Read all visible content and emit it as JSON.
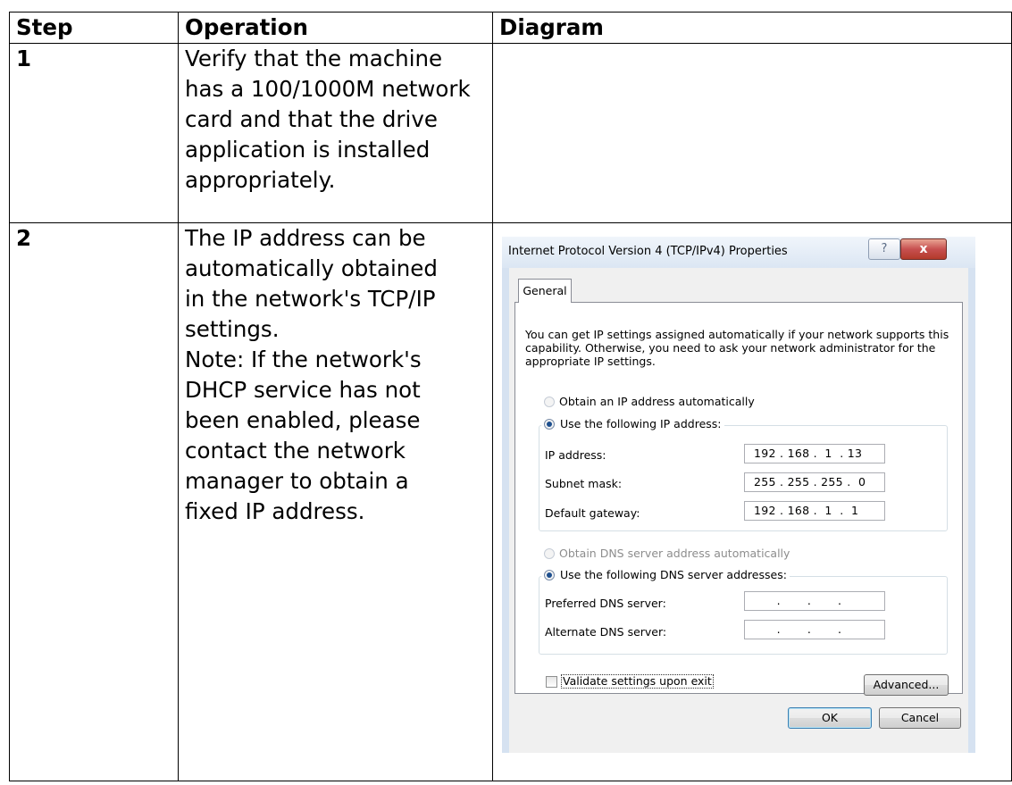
{
  "table": {
    "headers": {
      "step": "Step",
      "operation": "Operation",
      "diagram": "Diagram"
    },
    "rows": [
      {
        "step": "1",
        "operation": "Verify that the machine has a 100/1000M network card and that the drive application is installed appropriately."
      },
      {
        "step": "2",
        "operation_lines": [
          "The IP address can be",
          "automatically obtained",
          "in the network's TCP/IP",
          "settings.",
          "Note: If the network's",
          "DHCP service has not",
          "been enabled, please",
          "contact the network",
          "manager to obtain a",
          "fixed IP address."
        ]
      }
    ]
  },
  "dialog": {
    "title": "Internet Protocol Version 4 (TCP/IPv4) Properties",
    "help_label": "?",
    "close_label": "x",
    "tab": "General",
    "description": "You can get IP settings assigned automatically if your network supports this capability. Otherwise, you need to ask your network administrator for the appropriate IP settings.",
    "obtain_ip_auto": "Obtain an IP address automatically",
    "use_following_ip": "Use the following IP address:",
    "ip_address_label": "IP address:",
    "ip_address_value": "192 . 168 .  1  . 13",
    "subnet_mask_label": "Subnet mask:",
    "subnet_mask_value": "255 . 255 . 255 .  0",
    "default_gateway_label": "Default gateway:",
    "default_gateway_value": "192 . 168 .  1  .  1",
    "obtain_dns_auto": "Obtain DNS server address automatically",
    "use_following_dns": "Use the following DNS server addresses:",
    "preferred_dns_label": "Preferred DNS server:",
    "preferred_dns_value": "      .       .       .",
    "alternate_dns_label": "Alternate DNS server:",
    "alternate_dns_value": "      .       .       .",
    "validate_label": "Validate settings upon exit",
    "advanced_button": "Advanced...",
    "ok_button": "OK",
    "cancel_button": "Cancel"
  }
}
